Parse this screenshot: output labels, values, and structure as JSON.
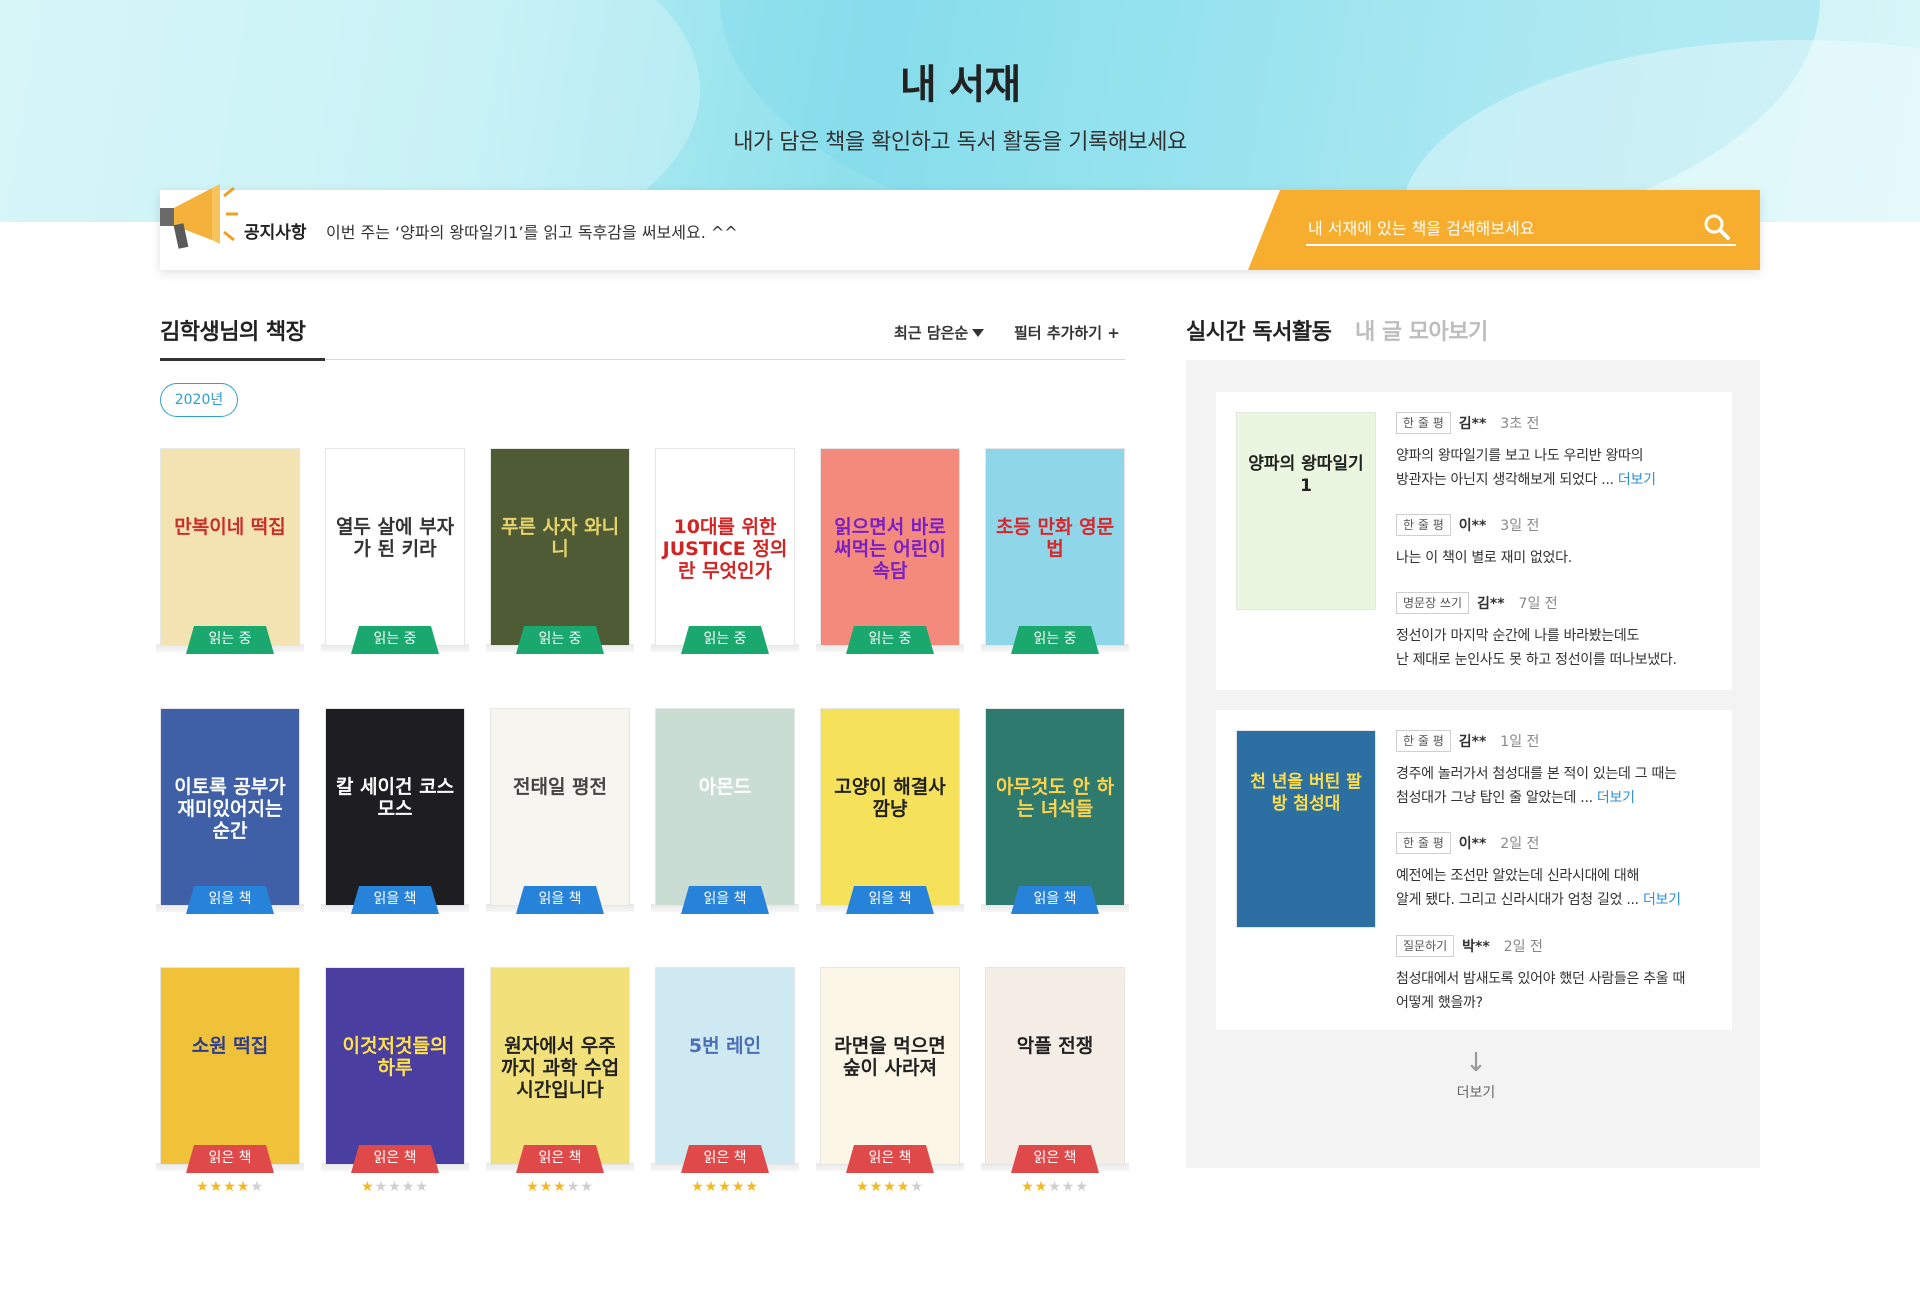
{
  "header": {
    "title": "내 서재",
    "subtitle": "내가 담은 책을 확인하고 독서 활동을 기록해보세요"
  },
  "notice": {
    "label": "공지사항",
    "text": "이번 주는 ‘양파의 왕따일기1’를 읽고 독후감을 써보세요. ^^",
    "search_placeholder": "내 서재에 있는 책을 검색해보세요"
  },
  "shelf": {
    "title": "김학생님의 책장",
    "sort_label": "최근 담은순",
    "filter_label": "필터 추가하기 +",
    "year_chip": "2020년",
    "colors": {
      "reading": "#1aa86e",
      "to_read": "#2782d9",
      "read": "#e0494a",
      "star": "#f6b81c"
    },
    "books": [
      {
        "cover_text": "만복이네 떡집",
        "status": "읽는 중",
        "bg": "#f4e3b2",
        "fg": "#c8302b"
      },
      {
        "cover_text": "열두 살에 부자가 된 키라",
        "status": "읽는 중",
        "bg": "#ffffff",
        "fg": "#333333"
      },
      {
        "cover_text": "푸른 사자 와니니",
        "status": "읽는 중",
        "bg": "#4f5b35",
        "fg": "#e7d36b"
      },
      {
        "cover_text": "10대를 위한 JUSTICE 정의란 무엇인가",
        "status": "읽는 중",
        "bg": "#ffffff",
        "fg": "#d32323"
      },
      {
        "cover_text": "읽으면서 바로 써먹는 어린이 속담",
        "status": "읽는 중",
        "bg": "#f48a7c",
        "fg": "#7a1fc7"
      },
      {
        "cover_text": "초등 만화 영문법",
        "status": "읽는 중",
        "bg": "#8fd6e8",
        "fg": "#d9262b"
      },
      {
        "cover_text": "이토록 공부가 재미있어지는 순간",
        "status": "읽을 책",
        "bg": "#3f5fa6",
        "fg": "#ffffff"
      },
      {
        "cover_text": "칼 세이건 코스모스",
        "status": "읽을 책",
        "bg": "#1d1d22",
        "fg": "#ffffff"
      },
      {
        "cover_text": "전태일 평전",
        "status": "읽을 책",
        "bg": "#f7f5ef",
        "fg": "#444444"
      },
      {
        "cover_text": "아몬드",
        "status": "읽을 책",
        "bg": "#c9ddd2",
        "fg": "#ffffff"
      },
      {
        "cover_text": "고양이 해결사 깜냥",
        "status": "읽을 책",
        "bg": "#f6e15a",
        "fg": "#222222"
      },
      {
        "cover_text": "아무것도 안 하는 녀석들",
        "status": "읽을 책",
        "bg": "#2f7a6e",
        "fg": "#ffd24a"
      },
      {
        "cover_text": "소원 떡집",
        "status": "읽은 책",
        "bg": "#f0c23a",
        "fg": "#2c3d8f",
        "stars": 4
      },
      {
        "cover_text": "이것저것들의 하루",
        "status": "읽은 책",
        "bg": "#4a3fa0",
        "fg": "#ffe14a",
        "stars": 1
      },
      {
        "cover_text": "원자에서 우주까지 과학 수업 시간입니다",
        "status": "읽은 책",
        "bg": "#f2e07a",
        "fg": "#222222",
        "stars": 3
      },
      {
        "cover_text": "5번 레인",
        "status": "읽은 책",
        "bg": "#cfe9f3",
        "fg": "#4a6fb3",
        "stars": 5
      },
      {
        "cover_text": "라면을 먹으면 숲이 사라져",
        "status": "읽은 책",
        "bg": "#fbf6e6",
        "fg": "#222222",
        "stars": 4
      },
      {
        "cover_text": "악플 전쟁",
        "status": "읽은 책",
        "bg": "#f4ede6",
        "fg": "#222222",
        "stars": 2
      }
    ]
  },
  "activity": {
    "title": "실시간 독서활동",
    "mine_tab": "내 글 모아보기",
    "more_label": "더보기",
    "cards": [
      {
        "cover_text": "양파의 왕따일기1",
        "entries": [
          {
            "tag": "한 줄 평",
            "user": "김**",
            "time": "3초 전",
            "lines": [
              "양파의 왕따일기를 보고 나도 우리반 왕따의",
              "방관자는 아닌지 생각해보게 되었다 ..."
            ],
            "more": "더보기"
          },
          {
            "tag": "한 줄 평",
            "user": "이**",
            "time": "3일 전",
            "lines": [
              "나는 이 책이 별로 재미 없었다."
            ],
            "more": ""
          },
          {
            "tag": "명문장 쓰기",
            "user": "김**",
            "time": "7일 전",
            "lines": [
              "정선이가 마지막 순간에 나를 바라봤는데도",
              "난 제대로 눈인사도 못 하고 정선이를 떠나보냈다."
            ],
            "more": ""
          }
        ]
      },
      {
        "cover_text": "천 년을 버틴 팔방 첨성대",
        "entries": [
          {
            "tag": "한 줄 평",
            "user": "김**",
            "time": "1일 전",
            "lines": [
              "경주에 놀러가서 첨성대를 본 적이 있는데 그 때는",
              "첨성대가 그냥 탑인 줄 알았는데 ..."
            ],
            "more": "더보기"
          },
          {
            "tag": "한 줄 평",
            "user": "이**",
            "time": "2일 전",
            "lines": [
              "예전에는 조선만 알았는데 신라시대에 대해",
              "알게 됐다. 그리고 신라시대가 엄청 길었 ..."
            ],
            "more": "더보기"
          },
          {
            "tag": "질문하기",
            "user": "박**",
            "time": "2일 전",
            "lines": [
              "첨성대에서 밤새도록 있어야 했던 사람들은 추울 때",
              "어떻게 했을까?"
            ],
            "more": ""
          }
        ]
      }
    ]
  }
}
